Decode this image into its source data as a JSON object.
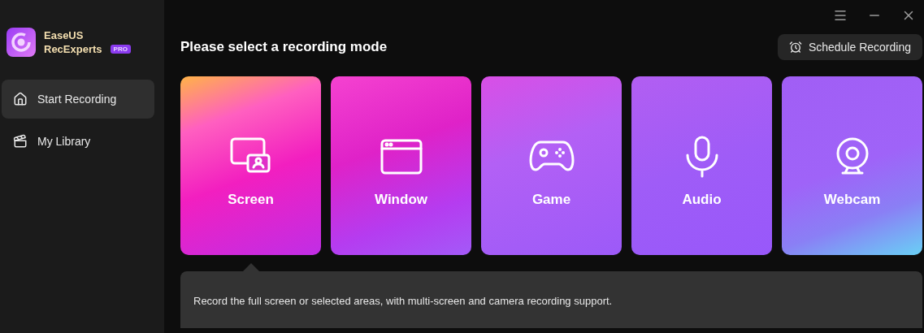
{
  "app": {
    "name_line1": "EaseUS",
    "name_line2": "RecExperts",
    "badge": "PRO"
  },
  "sidebar": {
    "items": [
      {
        "label": "Start Recording",
        "kind": "home",
        "selected": true
      },
      {
        "label": "My Library",
        "kind": "library",
        "selected": false
      }
    ]
  },
  "heading": "Please select a recording mode",
  "schedule_button": "Schedule Recording",
  "modes": [
    {
      "label": "Screen",
      "kind": "screen",
      "selected": true
    },
    {
      "label": "Window",
      "kind": "window",
      "selected": false
    },
    {
      "label": "Game",
      "kind": "game",
      "selected": false
    },
    {
      "label": "Audio",
      "kind": "audio",
      "selected": false
    },
    {
      "label": "Webcam",
      "kind": "webcam",
      "selected": false
    }
  ],
  "description": "Record the full screen or selected areas, with multi-screen and camera recording support."
}
